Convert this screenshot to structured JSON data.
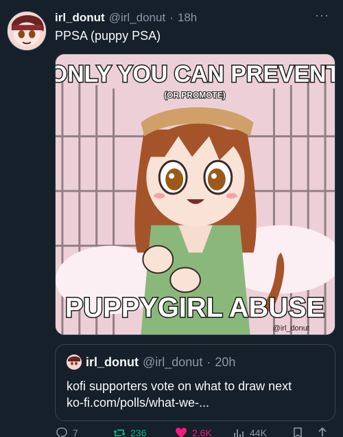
{
  "tweet": {
    "display_name": "irl_donut",
    "handle": "@irl_donut",
    "time": "18h",
    "text": "PPSA (puppy PSA)",
    "more_label": "···"
  },
  "media": {
    "top_line": "ONLY YOU CAN PREVENT",
    "sub_line": "(OR PROMOTE)",
    "bottom_line": "PUPPYGIRL ABUSE",
    "signature": "@irl_donut"
  },
  "quote": {
    "display_name": "irl_donut",
    "handle": "@irl_donut",
    "time": "20h",
    "line1": "kofi supporters vote on what to draw next",
    "line2": "ko-fi.com/polls/what-we-..."
  },
  "actions": {
    "replies": "7",
    "reposts": "236",
    "likes": "2.6K",
    "views": "44K"
  },
  "colors": {
    "background": "#15202b",
    "muted_text": "#8b98a5",
    "repost_green": "#00ba7c",
    "like_pink": "#f91880"
  },
  "icons": [
    "reply-icon",
    "repost-icon",
    "like-icon",
    "views-icon",
    "bookmark-icon",
    "share-icon"
  ]
}
